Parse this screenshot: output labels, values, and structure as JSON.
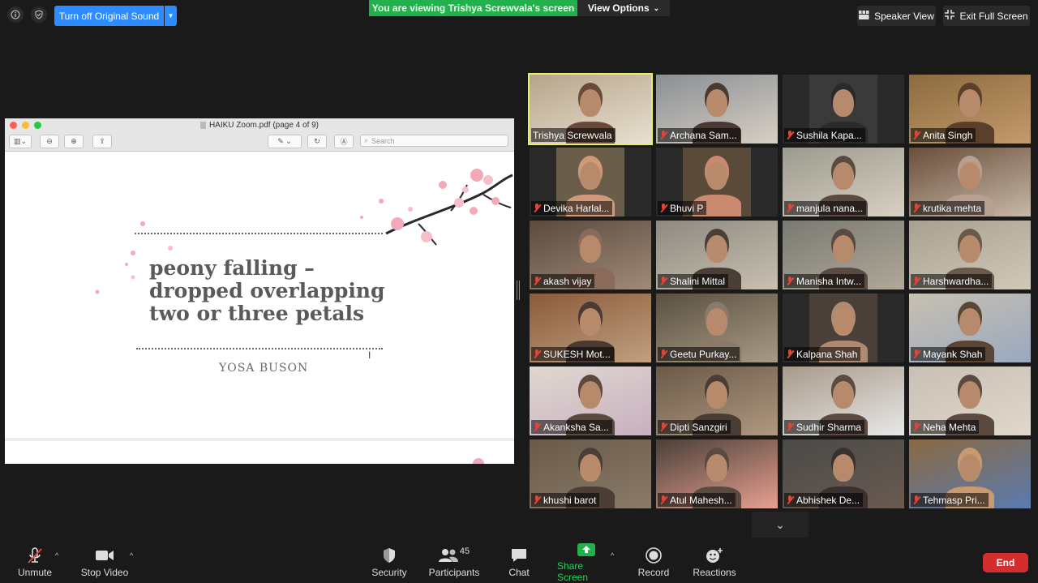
{
  "top_bar": {
    "turn_off_sound": "Turn off Original Sound",
    "viewing_banner": "You are viewing Trishya Screwvala's screen",
    "view_options": "View Options",
    "speaker_view": "Speaker View",
    "exit_full_screen": "Exit Full Screen"
  },
  "pdf": {
    "window_title": "HAIKU Zoom.pdf (page 4 of 9)",
    "search_placeholder": "Search",
    "poem_lines": [
      "peony falling –",
      "dropped overlapping",
      "two or three petals"
    ],
    "author": "YOSA BUSON"
  },
  "participants": [
    {
      "name": "Trishya Screwvala",
      "muted": false,
      "active": true
    },
    {
      "name": "Archana Sam...",
      "muted": true
    },
    {
      "name": "Sushila Kapa...",
      "muted": true
    },
    {
      "name": "Anita Singh",
      "muted": true
    },
    {
      "name": "Devika Harlal...",
      "muted": true
    },
    {
      "name": "Bhuvi P",
      "muted": true
    },
    {
      "name": "manjula nana...",
      "muted": true
    },
    {
      "name": "krutika mehta",
      "muted": true
    },
    {
      "name": "akash vijay",
      "muted": true
    },
    {
      "name": "Shalini Mittal",
      "muted": true
    },
    {
      "name": "Manisha Intw...",
      "muted": true
    },
    {
      "name": "Harshwardha...",
      "muted": true
    },
    {
      "name": "SUKESH Mot...",
      "muted": true
    },
    {
      "name": "Geetu Purkay...",
      "muted": true
    },
    {
      "name": "Kalpana Shah",
      "muted": true
    },
    {
      "name": "Mayank Shah",
      "muted": true
    },
    {
      "name": "Akanksha Sa...",
      "muted": true
    },
    {
      "name": "Dipti Sanzgiri",
      "muted": true
    },
    {
      "name": "Sudhir Sharma",
      "muted": true
    },
    {
      "name": "Neha Mehta",
      "muted": true
    },
    {
      "name": "khushi barot",
      "muted": true
    },
    {
      "name": "Atul Mahesh...",
      "muted": true
    },
    {
      "name": "Abhishek De...",
      "muted": true
    },
    {
      "name": "Tehmasp Pri...",
      "muted": true
    }
  ],
  "bottom_bar": {
    "unmute": "Unmute",
    "stop_video": "Stop Video",
    "security": "Security",
    "participants": "Participants",
    "participants_count": "45",
    "chat": "Chat",
    "share_screen": "Share Screen",
    "record": "Record",
    "reactions": "Reactions",
    "end": "End"
  },
  "colors": {
    "accent_blue": "#2d8cff",
    "share_green": "#23b14d",
    "end_red": "#d32d2d",
    "active_speaker": "#e3ef6d"
  }
}
